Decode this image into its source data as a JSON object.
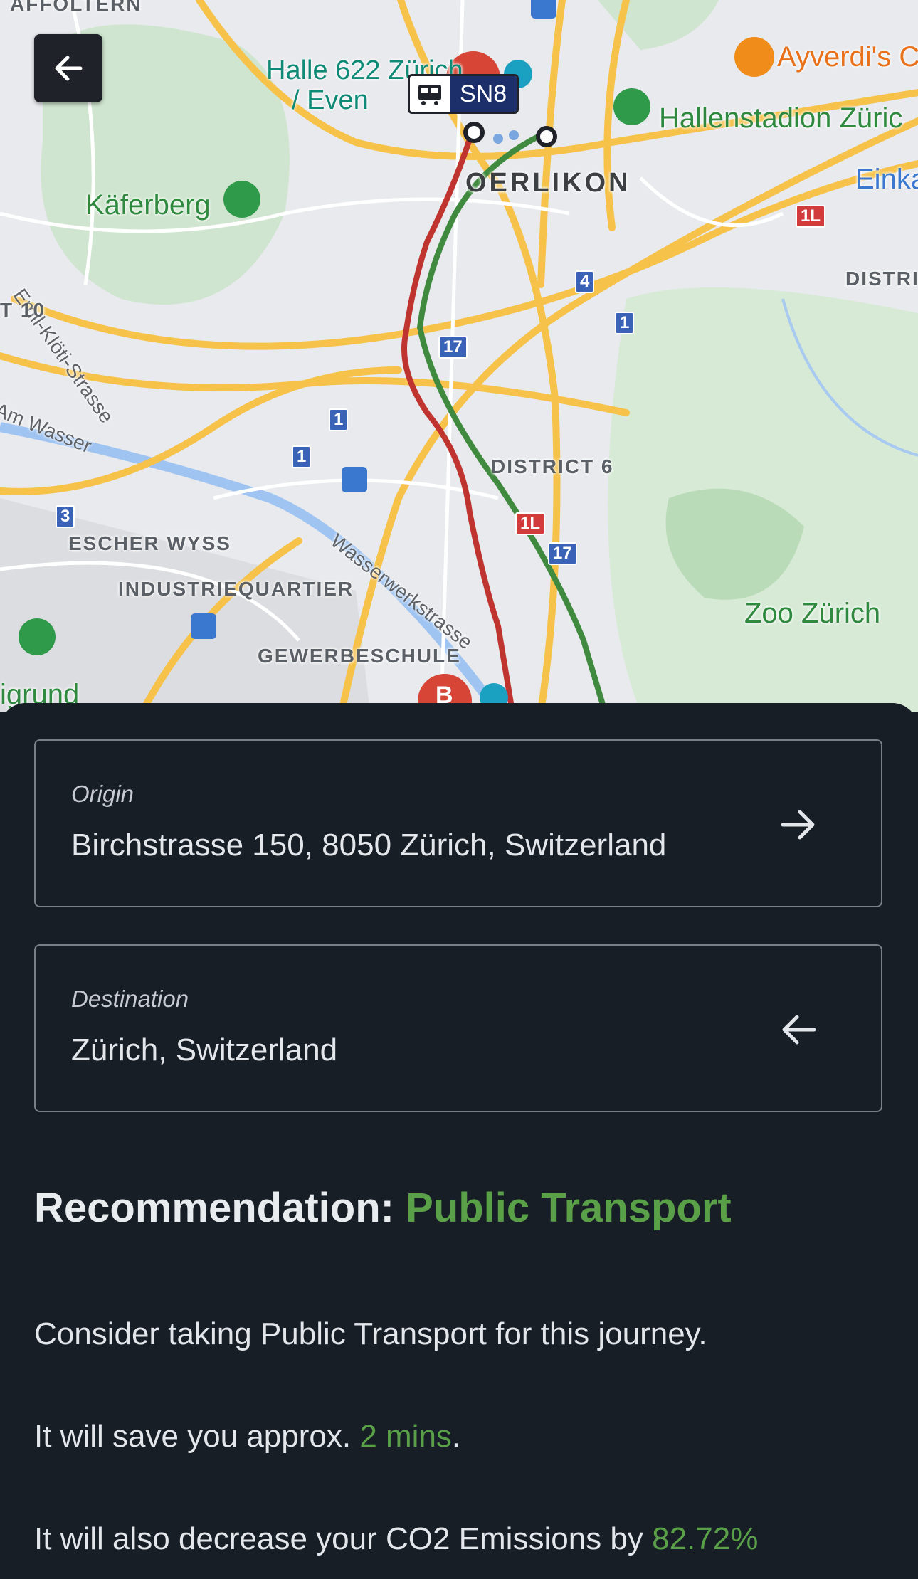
{
  "map": {
    "labels": {
      "affoltern": "AFFOLTERN",
      "halle": "Halle 622 Zürich",
      "halle2": "/ Even",
      "ayverdi": "Ayverdi's C",
      "hallenstadion": "Hallenstadion Züric",
      "oerlikon": "OERLIKON",
      "einka": "Einka",
      "kaferberg": "Käferberg",
      "emil": "Emil-Klöti-Strasse",
      "t10": "T 10",
      "district_right": "DISTRIC",
      "am_wasser": "Am Wasser",
      "district6": "DISTRICT 6",
      "escher": "ESCHER WYSS",
      "industrie": "INDUSTRIEQUARTIER",
      "wasserwerk": "Wasserwerkstrasse",
      "gewerbe": "GEWERBESCHULE",
      "zoo": "Zoo Zürich",
      "rigrund": "igrund"
    },
    "shields": {
      "s17a": "17",
      "s17b": "17",
      "s4": "4",
      "s1a": "1",
      "s1b": "1",
      "s1c": "1",
      "s3": "3",
      "s1l_a": "1L",
      "s1l_b": "1L"
    },
    "train_line": "SN8",
    "marker_b": "B",
    "colors": {
      "route_car": "#c0342f",
      "route_transit": "#3f8a3f"
    }
  },
  "form": {
    "origin_label": "Origin",
    "origin_value": "Birchstrasse 150, 8050 Zürich, Switzerland",
    "destination_label": "Destination",
    "destination_value": "Zürich, Switzerland"
  },
  "result": {
    "rec_prefix": "Recommendation:",
    "rec_mode": "Public Transport",
    "line1": "Consider taking Public Transport for this journey.",
    "line2_prefix": "It will save you approx.",
    "line2_value": "2 mins",
    "line2_suffix": ".",
    "line3_prefix": "It will also decrease your CO2 Emissions by",
    "line3_value": "82.72%"
  },
  "colors": {
    "panel_bg": "#171e26",
    "accent_green": "#5aa048"
  }
}
